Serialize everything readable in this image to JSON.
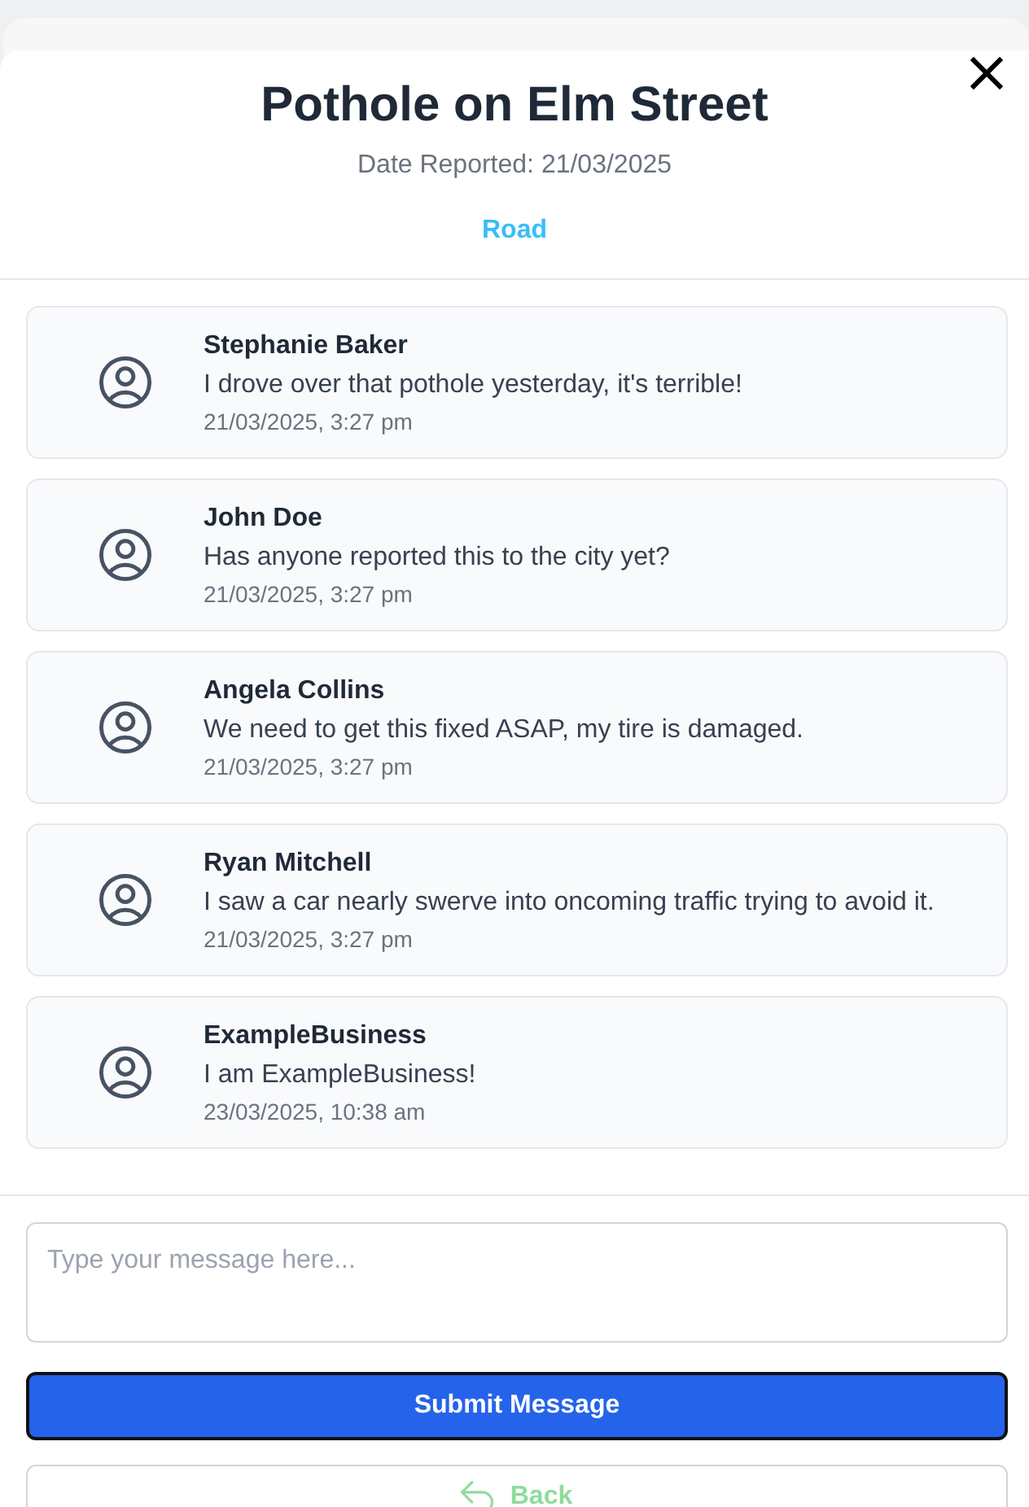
{
  "report": {
    "title": "Pothole on Elm Street",
    "date": "Date Reported: 21/03/2025",
    "category": "Road"
  },
  "comments": [
    {
      "author": "Stephanie Baker",
      "message": "I drove over that pothole yesterday, it's terrible!",
      "time": "21/03/2025, 3:27 pm"
    },
    {
      "author": "John Doe",
      "message": "Has anyone reported this to the city yet?",
      "time": "21/03/2025, 3:27 pm"
    },
    {
      "author": "Angela Collins",
      "message": "We need to get this fixed ASAP, my tire is damaged.",
      "time": "21/03/2025, 3:27 pm"
    },
    {
      "author": "Ryan Mitchell",
      "message": "I saw a car nearly swerve into oncoming traffic trying to avoid it.",
      "time": "21/03/2025, 3:27 pm"
    },
    {
      "author": "ExampleBusiness",
      "message": "I am ExampleBusiness!",
      "time": "23/03/2025, 10:38 am"
    }
  ],
  "composer": {
    "placeholder": "Type your message here..."
  },
  "buttons": {
    "submit": {
      "label": "Submit Message",
      "focused": true
    },
    "back": {
      "label": "Back"
    }
  }
}
